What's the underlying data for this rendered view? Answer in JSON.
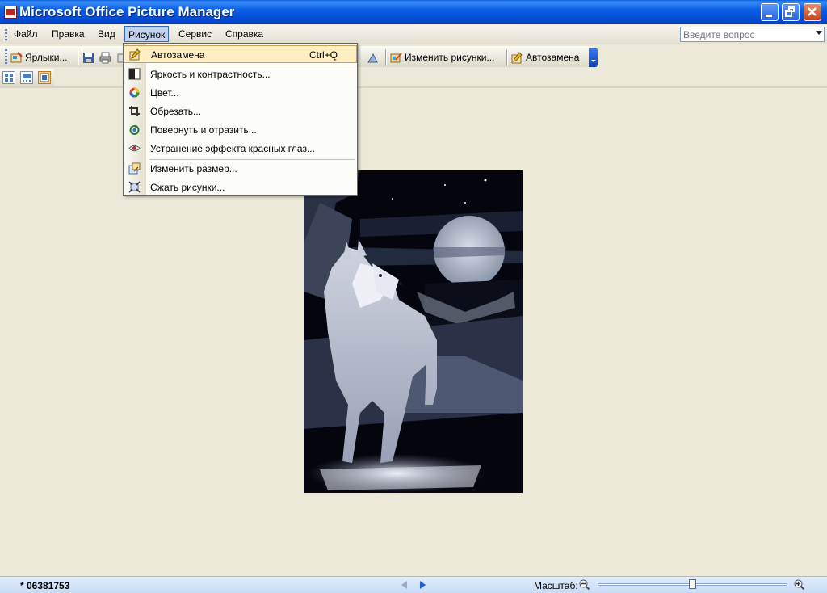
{
  "window": {
    "title": "Microsoft Office Picture Manager"
  },
  "menubar": {
    "items": [
      "Файл",
      "Правка",
      "Вид",
      "Рисунок",
      "Сервис",
      "Справка"
    ],
    "active": "Рисунок"
  },
  "help": {
    "placeholder": "Введите вопрос"
  },
  "toolbar": {
    "shortcuts_label": "Ярлыки...",
    "edit_pictures_label": "Изменить рисунки...",
    "autocorrect_label": "Автозамена"
  },
  "picture_menu": {
    "items": [
      {
        "label": "Автозамена",
        "shortcut": "Ctrl+Q",
        "icon": "autocorrect-icon"
      },
      {
        "label": "Яркость и контрастность...",
        "icon": "brightness-icon"
      },
      {
        "label": "Цвет...",
        "icon": "color-icon"
      },
      {
        "label": "Обрезать...",
        "icon": "crop-icon"
      },
      {
        "label": "Повернуть и отразить...",
        "icon": "rotate-icon"
      },
      {
        "label": "Устранение эффекта красных глаз...",
        "icon": "redeye-icon"
      },
      {
        "label": "Изменить размер...",
        "icon": "resize-icon"
      },
      {
        "label": "Сжать рисунки...",
        "icon": "compress-icon"
      }
    ]
  },
  "status": {
    "filename": "* 06381753",
    "zoom_label": "Масштаб:"
  },
  "colors": {
    "title_blue": "#0a5ee6",
    "menu_highlight": "#ffeec2",
    "workspace": "#ece9d8"
  }
}
